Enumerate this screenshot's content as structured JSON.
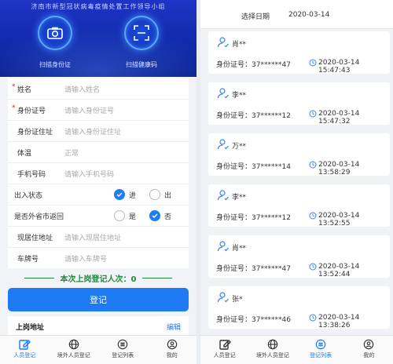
{
  "left": {
    "header_title": "济南市新型冠状病毒疫情处置工作领导小组",
    "scan_id_label": "扫描身份证",
    "scan_health_label": "扫描健康码",
    "fields": [
      {
        "label": "姓名",
        "required": true,
        "placeholder": "请输入姓名"
      },
      {
        "label": "身份证号",
        "required": true,
        "placeholder": "请输入身份证号"
      },
      {
        "label": "身份证住址",
        "required": false,
        "placeholder": "请输入身份证住址"
      },
      {
        "label": "体温",
        "required": false,
        "placeholder": "正常"
      },
      {
        "label": "手机号码",
        "required": false,
        "placeholder": "请输入手机号码"
      }
    ],
    "inout": {
      "label": "出入状态",
      "option_in": "进",
      "option_out": "出",
      "selected": "进"
    },
    "returned": {
      "label": "是否外省市返回",
      "option_yes": "是",
      "option_no": "否",
      "selected": "否"
    },
    "fields2": [
      {
        "label": "现居住地址",
        "placeholder": "请输入现居住地址"
      },
      {
        "label": "车牌号",
        "placeholder": "请输入车牌号"
      }
    ],
    "count_text": "本次上岗登记人次：0",
    "submit_label": "登记",
    "post_address_label": "上岗地址",
    "edit_label": "编辑"
  },
  "right": {
    "date_label": "选择日期",
    "date_value": "2020-03-14",
    "records": [
      {
        "name": "肖**",
        "id_label": "身份证号：",
        "id": "37******47",
        "time": "2020-03-14 15:47:43"
      },
      {
        "name": "李**",
        "id_label": "身份证号：",
        "id": "37******12",
        "time": "2020-03-14 15:47:32"
      },
      {
        "name": "万**",
        "id_label": "身份证号：",
        "id": "37******14",
        "time": "2020-03-14 13:58:29"
      },
      {
        "name": "李**",
        "id_label": "身份证号：",
        "id": "37******12",
        "time": "2020-03-14 13:52:55"
      },
      {
        "name": "肖**",
        "id_label": "身份证号：",
        "id": "37******47",
        "time": "2020-03-14 13:52:44"
      },
      {
        "name": "张*",
        "id_label": "身份证号：",
        "id": "37******46",
        "time": "2020-03-14 13:38:26"
      }
    ]
  },
  "tabs": [
    {
      "label": "人员登记",
      "icon": "edit-icon"
    },
    {
      "label": "境外人员登记",
      "icon": "globe-icon"
    },
    {
      "label": "登记列表",
      "icon": "list-icon"
    },
    {
      "label": "我的",
      "icon": "user-icon"
    }
  ],
  "colors": {
    "accent": "#1d7af3",
    "count_green": "#1f8a3b",
    "header_blue": "#1029a8"
  }
}
